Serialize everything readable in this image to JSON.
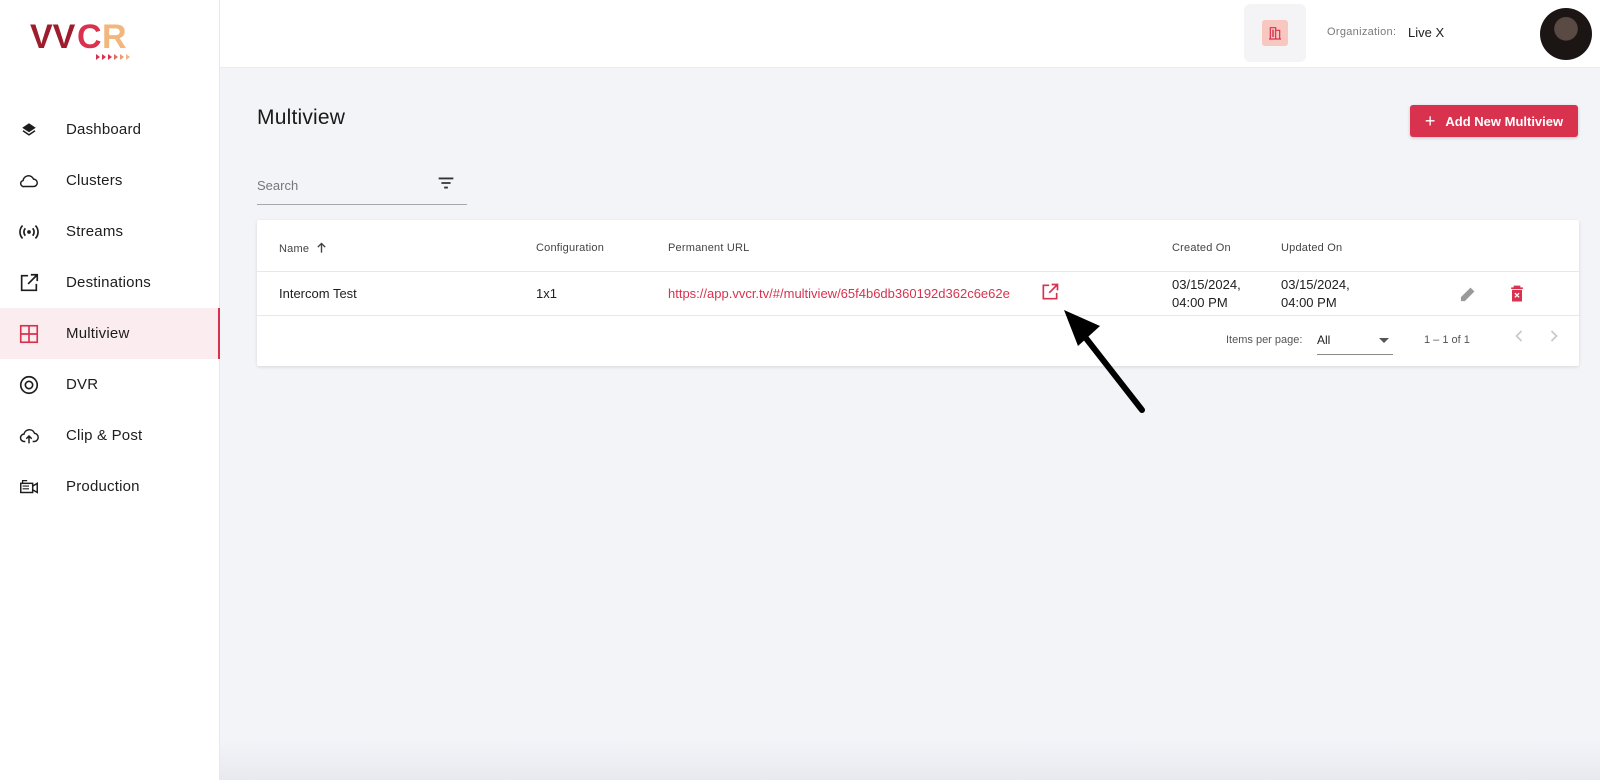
{
  "brand": {
    "logo_text": "VVCR",
    "accent_color": "#d8324f"
  },
  "sidebar": {
    "items": [
      {
        "label": "Dashboard",
        "icon": "layers-icon",
        "active": false
      },
      {
        "label": "Clusters",
        "icon": "cloud-icon",
        "active": false
      },
      {
        "label": "Streams",
        "icon": "broadcast-icon",
        "active": false
      },
      {
        "label": "Destinations",
        "icon": "external-link-icon",
        "active": false
      },
      {
        "label": "Multiview",
        "icon": "grid-icon",
        "active": true
      },
      {
        "label": "DVR",
        "icon": "disc-icon",
        "active": false
      },
      {
        "label": "Clip & Post",
        "icon": "cloud-upload-icon",
        "active": false
      },
      {
        "label": "Production",
        "icon": "video-camera-icon",
        "active": false
      }
    ]
  },
  "topbar": {
    "org_label": "Organization:",
    "org_value": "Live X"
  },
  "main": {
    "title": "Multiview",
    "add_button_label": "Add New Multiview",
    "search_placeholder": "Search"
  },
  "table": {
    "columns": [
      "Name",
      "Configuration",
      "Permanent URL",
      "Created On",
      "Updated On"
    ],
    "sort_column": "Name",
    "sort_direction": "asc",
    "rows": [
      {
        "name": "Intercom Test",
        "configuration": "1x1",
        "url": "https://app.vvcr.tv/#/multiview/65f4b6db360192d362c6e62e",
        "created_date": "03/15/2024,",
        "created_time": "04:00 PM",
        "updated_date": "03/15/2024,",
        "updated_time": "04:00 PM"
      }
    ]
  },
  "pagination": {
    "items_per_page_label": "Items per page:",
    "items_per_page_value": "All",
    "range": "1 – 1 of 1"
  }
}
